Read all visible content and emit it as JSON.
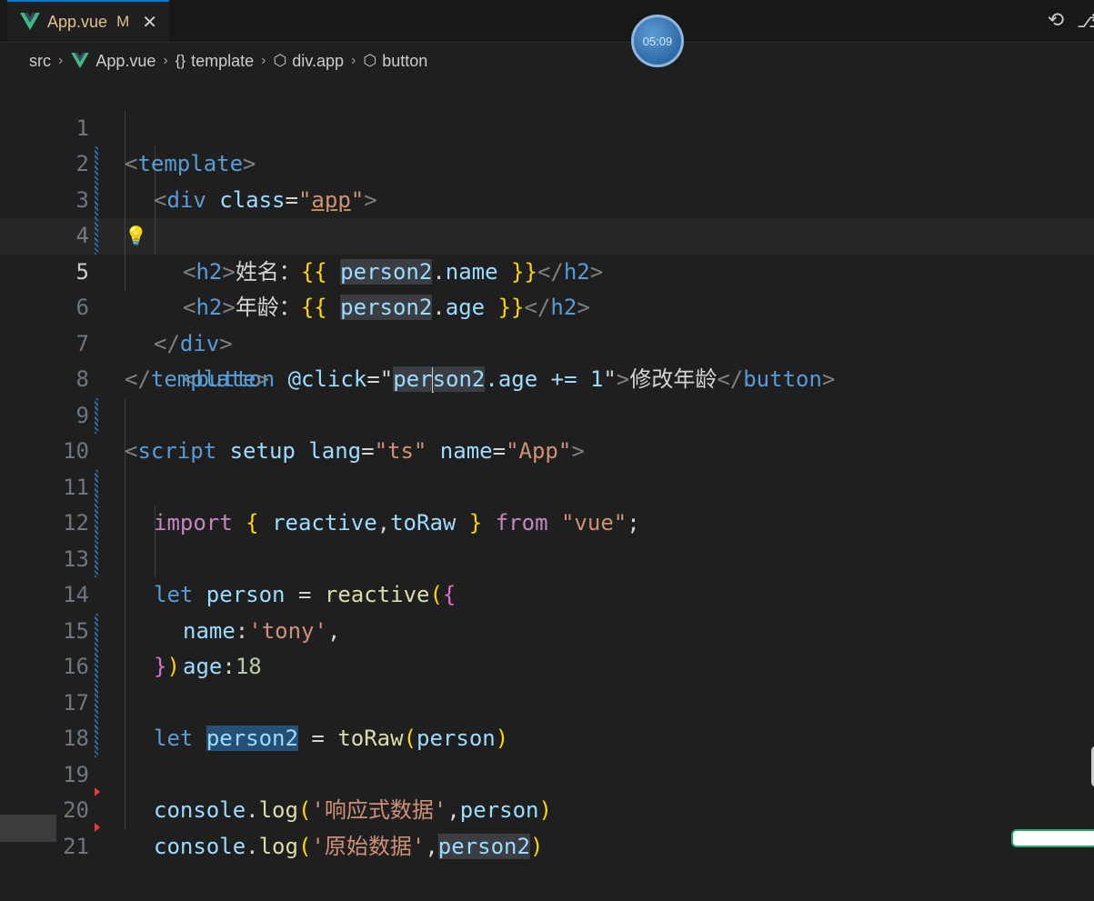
{
  "tab": {
    "title": "App.vue",
    "modified": "M",
    "close": "✕"
  },
  "timer": "05:09",
  "breadcrumb": {
    "items": [
      "src",
      "App.vue",
      "template",
      "div.app",
      "button"
    ],
    "icons": [
      "folder",
      "vue-icon",
      "braces-icon",
      "cube-icon",
      "cube-icon"
    ],
    "braces": "{}"
  },
  "editor": {
    "active_line": 5,
    "line_numbers": [
      "1",
      "2",
      "3",
      "4",
      "5",
      "6",
      "7",
      "8",
      "9",
      "10",
      "11",
      "12",
      "13",
      "14",
      "15",
      "16",
      "17",
      "18",
      "19",
      "20",
      "21"
    ],
    "lines": {
      "l1": {
        "p1": "<",
        "tag": "template",
        "p2": ">"
      },
      "l2": {
        "p1": "<",
        "tag": "div",
        "attr": " class",
        "eq": "=",
        "q1": "\"",
        "val": "app",
        "q2": "\"",
        "p2": ">"
      },
      "l3": {
        "p1": "<",
        "tag": "h2",
        "p2": ">",
        "txt": "姓名：",
        "b1": "{{",
        "sp": " ",
        "var": "person2",
        "dot": ".",
        "prop": "name",
        "sp2": " ",
        "b2": "}}",
        "p3": "</",
        "tag2": "h2",
        "p4": ">"
      },
      "l4": {
        "p1": "<",
        "tag": "h2",
        "p2": ">",
        "txt": "年龄：",
        "b1": "{{",
        "sp": " ",
        "var": "person2",
        "dot": ".",
        "prop": "age",
        "sp2": " ",
        "b2": "}}",
        "p3": "</",
        "tag2": "h2",
        "p4": ">"
      },
      "l5": {
        "p1": "<",
        "tag": "button",
        "attr": " @click",
        "eq": "=",
        "q1": "\"",
        "var_a": "per",
        "var_b": "son2",
        "rest": ".age += 1",
        "q2": "\"",
        "p2": ">",
        "txt": "修改年龄",
        "p3": "</",
        "tag2": "button",
        "p4": ">"
      },
      "l6": {
        "p1": "</",
        "tag": "div",
        "p2": ">"
      },
      "l7": {
        "p1": "</",
        "tag": "template",
        "p2": ">"
      },
      "l9": {
        "p1": "<",
        "tag": "script",
        "a1": " setup",
        "a2": " lang",
        "eq1": "=",
        "v1": "\"ts\"",
        "a3": " name",
        "eq2": "=",
        "v2": "\"App\"",
        "p2": ">"
      },
      "l10": {
        "kw": "import",
        "b1": " { ",
        "v1": "reactive",
        "c": ",",
        "v2": "toRaw",
        "b2": " } ",
        "kw2": "from",
        "s": " \"vue\"",
        "semi": ";"
      },
      "l12": {
        "kw": "let",
        "v": " person",
        "eq": " = ",
        "fn": "reactive",
        "b1": "(",
        "b2": "{"
      },
      "l13": {
        "k": "name",
        "c": ":",
        "s": "'tony'",
        "comma": ","
      },
      "l14": {
        "k": "age",
        "c": ":",
        "n": "18"
      },
      "l15": {
        "b1": "}",
        "b2": ")"
      },
      "l16": {
        "kw": "let",
        "v": "person2",
        "eq": " = ",
        "fn": "toRaw",
        "b1": "(",
        "arg": "person",
        "b2": ")"
      },
      "l18": {
        "obj": "console",
        "dot": ".",
        "fn": "log",
        "b1": "(",
        "s": "'响应式数据'",
        "c": ",",
        "arg": "person",
        "b2": ")"
      },
      "l19": {
        "obj": "console",
        "dot": ".",
        "fn": "log",
        "b1": "(",
        "s": "'原始数据'",
        "c": ",",
        "arg": "person2",
        "b2": ")"
      }
    }
  }
}
